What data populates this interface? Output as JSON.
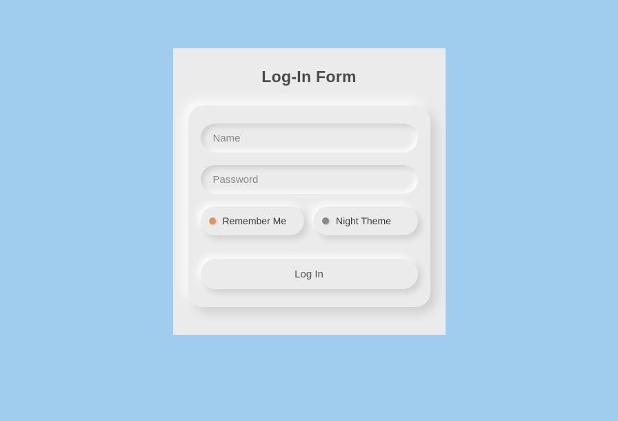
{
  "form": {
    "title": "Log-In Form",
    "name_placeholder": "Name",
    "name_value": "",
    "password_placeholder": "Password",
    "password_value": "",
    "remember_label": "Remember Me",
    "theme_label": "Night Theme",
    "submit_label": "Log In"
  },
  "colors": {
    "background": "#a0cdee",
    "panel": "#ebebeb",
    "accent": "#e8915f"
  }
}
